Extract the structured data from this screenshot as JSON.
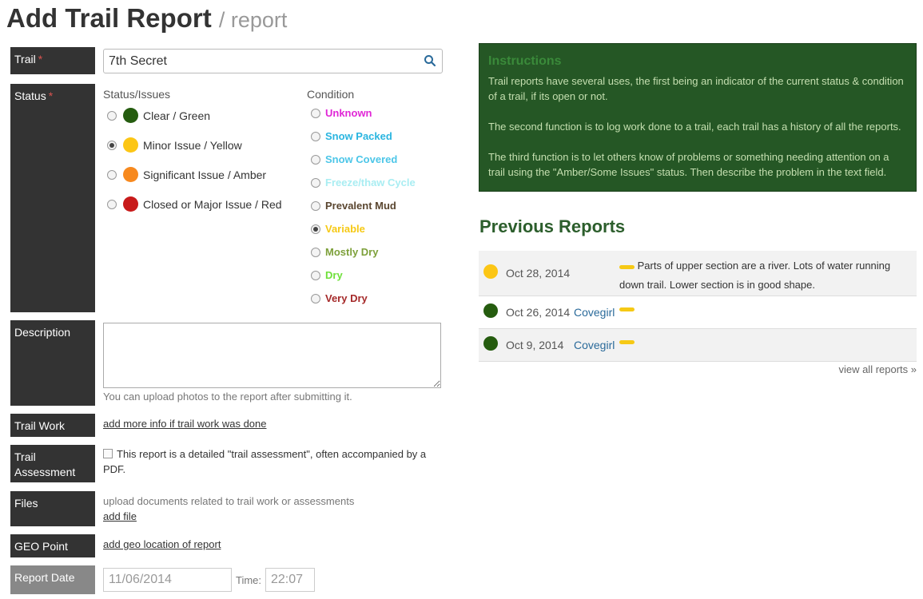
{
  "page": {
    "title": "Add Trail Report",
    "subtitle": "/ report"
  },
  "colors": {
    "green": "#255c0f",
    "yellow": "#fcc615",
    "amber": "#f7891e",
    "red": "#c81a1a",
    "accent": "#2c5e2c"
  },
  "trail": {
    "label": "Trail",
    "required_mark": "*",
    "value": "7th Secret"
  },
  "status": {
    "label": "Status",
    "required_mark": "*",
    "issues_heading": "Status/Issues",
    "issues": [
      {
        "label": "Clear / Green",
        "color": "#255c0f",
        "checked": false
      },
      {
        "label": "Minor Issue / Yellow",
        "color": "#fcc615",
        "checked": true
      },
      {
        "label": "Significant Issue / Amber",
        "color": "#f7891e",
        "checked": false
      },
      {
        "label": "Closed or Major Issue / Red",
        "color": "#c81a1a",
        "checked": false
      }
    ],
    "condition_heading": "Condition",
    "conditions": [
      {
        "label": "Unknown",
        "color": "#e026d6",
        "checked": false
      },
      {
        "label": "Snow Packed",
        "color": "#2ab5e0",
        "checked": false
      },
      {
        "label": "Snow Covered",
        "color": "#4cc6e8",
        "checked": false
      },
      {
        "label": "Freeze/thaw Cycle",
        "color": "#a9edf2",
        "checked": false
      },
      {
        "label": "Prevalent Mud",
        "color": "#5a4630",
        "checked": false
      },
      {
        "label": "Variable",
        "color": "#f6c915",
        "checked": true
      },
      {
        "label": "Mostly Dry",
        "color": "#7da03a",
        "checked": false
      },
      {
        "label": "Dry",
        "color": "#6fe03a",
        "checked": false
      },
      {
        "label": "Very Dry",
        "color": "#a52a2a",
        "checked": false
      }
    ]
  },
  "description": {
    "label": "Description",
    "hint": "You can upload photos to the report after submitting it."
  },
  "trail_work": {
    "label": "Trail Work",
    "link": "add more info if trail work was done"
  },
  "assessment": {
    "label_line1": "Trail",
    "label_line2": "Assessment",
    "text": "This report is a detailed \"trail assessment\", often accompanied by a PDF."
  },
  "files": {
    "label": "Files",
    "hint": "upload documents related to trail work or assessments",
    "link": "add file"
  },
  "geo": {
    "label": "GEO Point",
    "link": "add geo location of report"
  },
  "report_date": {
    "label": "Report Date",
    "date_value": "11/06/2014",
    "time_label": "Time:",
    "time_value": "22:07"
  },
  "instructions": {
    "heading": "Instructions",
    "paragraphs": [
      "Trail reports have several uses, the first being an indicator of the current status & condition of a trail, if its open or not.",
      "The second function is to log work done to a trail, each trail has a history of all the reports.",
      "The third function is to let others know of problems or something needing attention on a trail using the \"Amber/Some Issues\" status. Then describe the problem in the text field."
    ]
  },
  "previous_reports": {
    "heading": "Previous Reports",
    "view_all": "view all reports »",
    "reports": [
      {
        "date": "Oct 28, 2014",
        "user": "",
        "status_color": "#fcc615",
        "text": "Parts of upper section are a river. Lots of water running down trail. Lower section is in good shape."
      },
      {
        "date": "Oct 26, 2014",
        "user": "Covegirl",
        "status_color": "#255c0f",
        "text": ""
      },
      {
        "date": "Oct 9, 2014",
        "user": "Covegirl",
        "status_color": "#255c0f",
        "text": ""
      }
    ]
  }
}
